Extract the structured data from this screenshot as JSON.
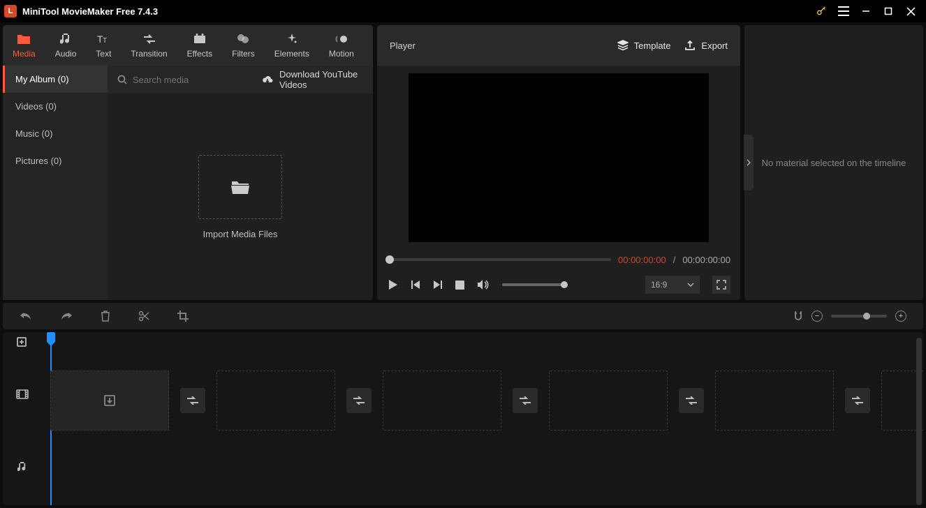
{
  "app": {
    "title": "MiniTool MovieMaker Free 7.4.3"
  },
  "tabs": {
    "media": "Media",
    "audio": "Audio",
    "text": "Text",
    "transition": "Transition",
    "effects": "Effects",
    "filters": "Filters",
    "elements": "Elements",
    "motion": "Motion"
  },
  "cats": {
    "album": "My Album (0)",
    "videos": "Videos (0)",
    "music": "Music (0)",
    "pictures": "Pictures (0)"
  },
  "search": {
    "placeholder": "Search media"
  },
  "dlyt": "Download YouTube Videos",
  "import_label": "Import Media Files",
  "player": {
    "title": "Player",
    "template": "Template",
    "export": "Export",
    "ratio": "16:9",
    "cur": "00:00:00:00",
    "sep": "/",
    "tot": "00:00:00:00"
  },
  "rightmsg": "No material selected on the timeline"
}
